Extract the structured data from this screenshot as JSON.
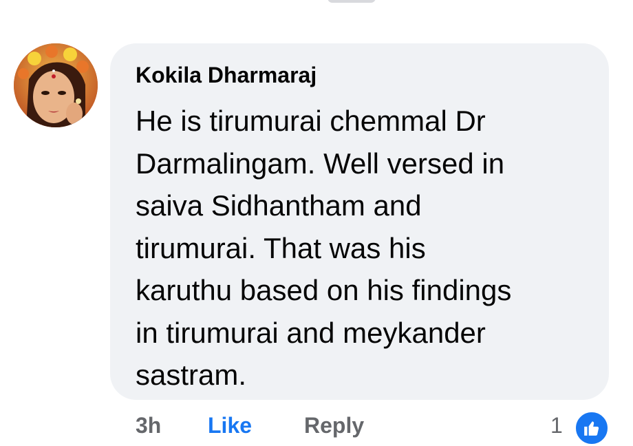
{
  "comment": {
    "author": "Kokila Dharmaraj",
    "text": "He is tirumurai chemmal Dr\nDarmalingam. Well versed in\nsaiva Sidhantham and\ntirumurai. That was his\nkaruthu based on his findings\nin tirumurai and meykander\nsastram."
  },
  "actions": {
    "time": "3h",
    "like_label": "Like",
    "reply_label": "Reply",
    "reaction_count": "1",
    "reaction_icon": "thumbs-up-icon"
  },
  "colors": {
    "bubble": "#f0f2f5",
    "text": "#050505",
    "link_blue": "#1877f2",
    "meta_gray": "#65676b"
  }
}
